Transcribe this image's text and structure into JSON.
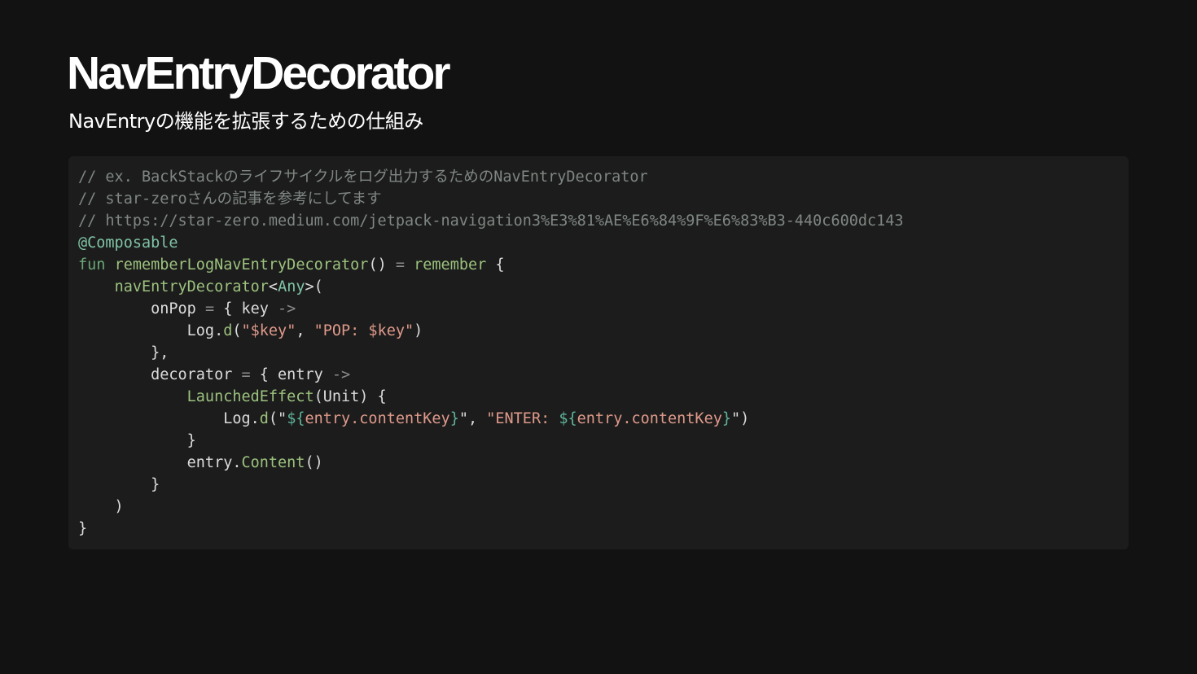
{
  "slide": {
    "title": "NavEntryDecorator",
    "subtitle": "NavEntryの機能を拡張するための仕組み"
  },
  "code": {
    "language": "kotlin",
    "lines": [
      [
        {
          "t": "comment",
          "v": "// ex. BackStackのライフサイクルをログ出力するためのNavEntryDecorator"
        }
      ],
      [
        {
          "t": "comment",
          "v": "// star-zeroさんの記事を参考にしてます"
        }
      ],
      [
        {
          "t": "comment",
          "v": "// https://star-zero.medium.com/jetpack-navigation3%E3%81%AE%E6%84%9F%E6%83%B3-440c600dc143"
        }
      ],
      [
        {
          "t": "ann",
          "v": "@Composable"
        }
      ],
      [
        {
          "t": "kw",
          "v": "fun "
        },
        {
          "t": "fn",
          "v": "rememberLogNavEntryDecorator"
        },
        {
          "t": "plain",
          "v": "() "
        },
        {
          "t": "op",
          "v": "="
        },
        {
          "t": "plain",
          "v": " "
        },
        {
          "t": "fn",
          "v": "remember"
        },
        {
          "t": "plain",
          "v": " {"
        }
      ],
      [
        {
          "t": "plain",
          "v": "    "
        },
        {
          "t": "fn",
          "v": "navEntryDecorator"
        },
        {
          "t": "plain",
          "v": "<"
        },
        {
          "t": "type",
          "v": "Any"
        },
        {
          "t": "plain",
          "v": ">("
        }
      ],
      [
        {
          "t": "plain",
          "v": "        onPop "
        },
        {
          "t": "op",
          "v": "="
        },
        {
          "t": "plain",
          "v": " { key "
        },
        {
          "t": "op",
          "v": "->"
        }
      ],
      [
        {
          "t": "plain",
          "v": "            Log."
        },
        {
          "t": "fn",
          "v": "d"
        },
        {
          "t": "plain",
          "v": "("
        },
        {
          "t": "str",
          "v": "\"$key\""
        },
        {
          "t": "plain",
          "v": ", "
        },
        {
          "t": "str",
          "v": "\"POP: $key\""
        },
        {
          "t": "plain",
          "v": ")"
        }
      ],
      [
        {
          "t": "plain",
          "v": "        },"
        }
      ],
      [
        {
          "t": "plain",
          "v": "        decorator "
        },
        {
          "t": "op",
          "v": "="
        },
        {
          "t": "plain",
          "v": " { entry "
        },
        {
          "t": "op",
          "v": "->"
        }
      ],
      [
        {
          "t": "plain",
          "v": "            "
        },
        {
          "t": "fn",
          "v": "LaunchedEffect"
        },
        {
          "t": "plain",
          "v": "(Unit) {"
        }
      ],
      [
        {
          "t": "plain",
          "v": "                Log."
        },
        {
          "t": "fn",
          "v": "d"
        },
        {
          "t": "plain",
          "v": "(\""
        },
        {
          "t": "tpl",
          "v": "${"
        },
        {
          "t": "str",
          "v": "entry.contentKey"
        },
        {
          "t": "tpl",
          "v": "}"
        },
        {
          "t": "plain",
          "v": "\", "
        },
        {
          "t": "str",
          "v": "\"ENTER: "
        },
        {
          "t": "tpl",
          "v": "${"
        },
        {
          "t": "str",
          "v": "entry.contentKey"
        },
        {
          "t": "tpl",
          "v": "}"
        },
        {
          "t": "plain",
          "v": "\")"
        }
      ],
      [
        {
          "t": "plain",
          "v": "            }"
        }
      ],
      [
        {
          "t": "plain",
          "v": "            entry."
        },
        {
          "t": "fn",
          "v": "Content"
        },
        {
          "t": "plain",
          "v": "()"
        }
      ],
      [
        {
          "t": "plain",
          "v": "        }"
        }
      ],
      [
        {
          "t": "plain",
          "v": "    )"
        }
      ],
      [
        {
          "t": "plain",
          "v": "}"
        }
      ]
    ]
  },
  "colors": {
    "background": "#121213",
    "code_background": "#1c1c1c",
    "comment": "#7f8782",
    "keyword": "#6aa877",
    "function": "#9cc27e",
    "string": "#e09a8b",
    "template": "#5fb39a",
    "annotation": "#7fc4a6"
  }
}
